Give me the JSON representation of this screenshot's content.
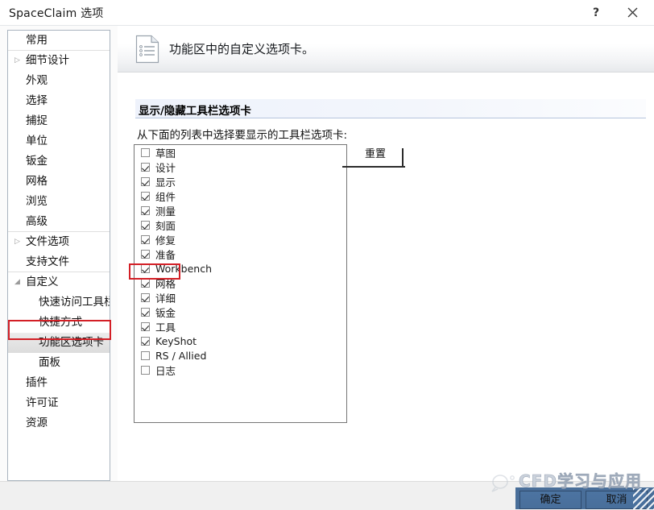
{
  "window": {
    "title": "SpaceClaim 选项",
    "help_glyph": "?",
    "close_glyph": "✕"
  },
  "sidebar": {
    "items": [
      {
        "label": "常用",
        "indent": 0,
        "arrow": "",
        "selected": false,
        "separator": true
      },
      {
        "label": "细节设计",
        "indent": 0,
        "arrow": "▷",
        "selected": false,
        "separator": false
      },
      {
        "label": "外观",
        "indent": 0,
        "arrow": "",
        "selected": false,
        "separator": false
      },
      {
        "label": "选择",
        "indent": 0,
        "arrow": "",
        "selected": false,
        "separator": false
      },
      {
        "label": "捕捉",
        "indent": 0,
        "arrow": "",
        "selected": false,
        "separator": false
      },
      {
        "label": "单位",
        "indent": 0,
        "arrow": "",
        "selected": false,
        "separator": false
      },
      {
        "label": "钣金",
        "indent": 0,
        "arrow": "",
        "selected": false,
        "separator": false
      },
      {
        "label": "网格",
        "indent": 0,
        "arrow": "",
        "selected": false,
        "separator": false
      },
      {
        "label": "浏览",
        "indent": 0,
        "arrow": "",
        "selected": false,
        "separator": false
      },
      {
        "label": "高级",
        "indent": 0,
        "arrow": "",
        "selected": false,
        "separator": true
      },
      {
        "label": "文件选项",
        "indent": 0,
        "arrow": "▷",
        "selected": false,
        "separator": false
      },
      {
        "label": "支持文件",
        "indent": 0,
        "arrow": "",
        "selected": false,
        "separator": true
      },
      {
        "label": "自定义",
        "indent": 0,
        "arrow": "◢",
        "selected": false,
        "separator": false
      },
      {
        "label": "快速访问工具栏",
        "indent": 1,
        "arrow": "",
        "selected": false,
        "separator": false
      },
      {
        "label": "快捷方式",
        "indent": 1,
        "arrow": "",
        "selected": false,
        "separator": false
      },
      {
        "label": "功能区选项卡",
        "indent": 1,
        "arrow": "",
        "selected": true,
        "separator": false
      },
      {
        "label": "面板",
        "indent": 1,
        "arrow": "",
        "selected": false,
        "separator": false
      },
      {
        "label": "插件",
        "indent": 0,
        "arrow": "",
        "selected": false,
        "separator": false
      },
      {
        "label": "许可证",
        "indent": 0,
        "arrow": "",
        "selected": false,
        "separator": false
      },
      {
        "label": "资源",
        "indent": 0,
        "arrow": "",
        "selected": false,
        "separator": false
      }
    ]
  },
  "page": {
    "header_title": "功能区中的自定义选项卡。",
    "section_title": "显示/隐藏工具栏选项卡",
    "list_caption": "从下面的列表中选择要显示的工具栏选项卡:",
    "reset_label": "重置"
  },
  "tab_list": {
    "items": [
      {
        "label": "草图",
        "checked": false
      },
      {
        "label": "设计",
        "checked": true
      },
      {
        "label": "显示",
        "checked": true
      },
      {
        "label": "组件",
        "checked": true
      },
      {
        "label": "测量",
        "checked": true
      },
      {
        "label": "刻面",
        "checked": true
      },
      {
        "label": "修复",
        "checked": true
      },
      {
        "label": "准备",
        "checked": true
      },
      {
        "label": "Workbench",
        "checked": true
      },
      {
        "label": "网格",
        "checked": true
      },
      {
        "label": "详细",
        "checked": true
      },
      {
        "label": "钣金",
        "checked": true
      },
      {
        "label": "工具",
        "checked": true
      },
      {
        "label": "KeyShot",
        "checked": true
      },
      {
        "label": "RS / Allied",
        "checked": false
      },
      {
        "label": "日志",
        "checked": false
      }
    ]
  },
  "footer": {
    "ok_label": "确定",
    "cancel_label": "取消"
  },
  "watermark": {
    "text": "CFD学习与应用"
  },
  "colors": {
    "highlight_red": "#d31f26",
    "section_blue": "#eef2fb",
    "panel_border": "#a9b4bf",
    "watermark_blue": "#20528c"
  }
}
